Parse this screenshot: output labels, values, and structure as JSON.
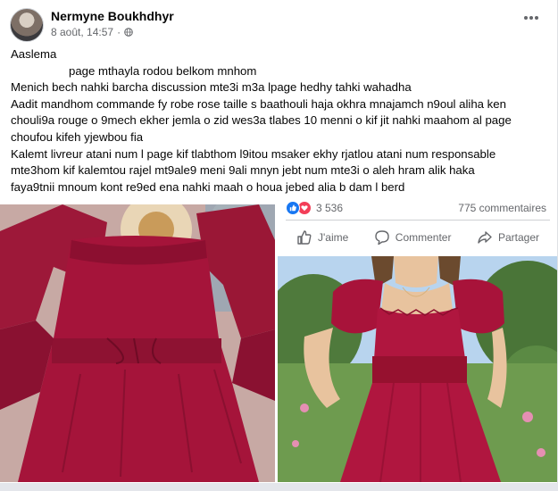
{
  "post": {
    "author": "Nermyne Boukhdhyr",
    "timestamp": "8 août, 14:57",
    "separator": "·",
    "lines": [
      "Aaslema",
      "page mthayla rodou belkom mnhom",
      "Menich bech nahki barcha discussion mte3i m3a lpage hedhy tahki wahadha",
      "Aadit mandhom commande fy robe rose taille s baathouli haja okhra mnajamch n9oul aliha ken",
      "chouli9a rouge o 9mech ekher jemla o zid wes3a tlabes 10 menni  o kif jit nahki maahom al page",
      "choufou kifeh yjewbou fia",
      "Kalemt livreur atani num l page kif tlabthom l9itou msaker ekhy rjatlou atani num responsable",
      "mte3hom kif kalemtou rajel mt9ale9 meni 9ali mnyn jebt num mte3i o aleh hram alik haka",
      "faya9tnii mnoum kont re9ed  ena nahki maah o houa jebed alia b dam l berd"
    ]
  },
  "engagement": {
    "reaction_count": "3 536",
    "comments": "775 commentaires"
  },
  "actions": {
    "like": "J'aime",
    "comment": "Commenter",
    "share": "Partager"
  },
  "icons": {
    "more": "more-options-icon",
    "audience": "globe-icon",
    "like": "thumbs-up-icon",
    "comment": "comment-bubble-icon",
    "share": "share-arrow-icon"
  },
  "colors": {
    "accent": "#1877f2",
    "love": "#f33e58",
    "secondary_text": "#65676b",
    "dress": "#a5143a"
  }
}
